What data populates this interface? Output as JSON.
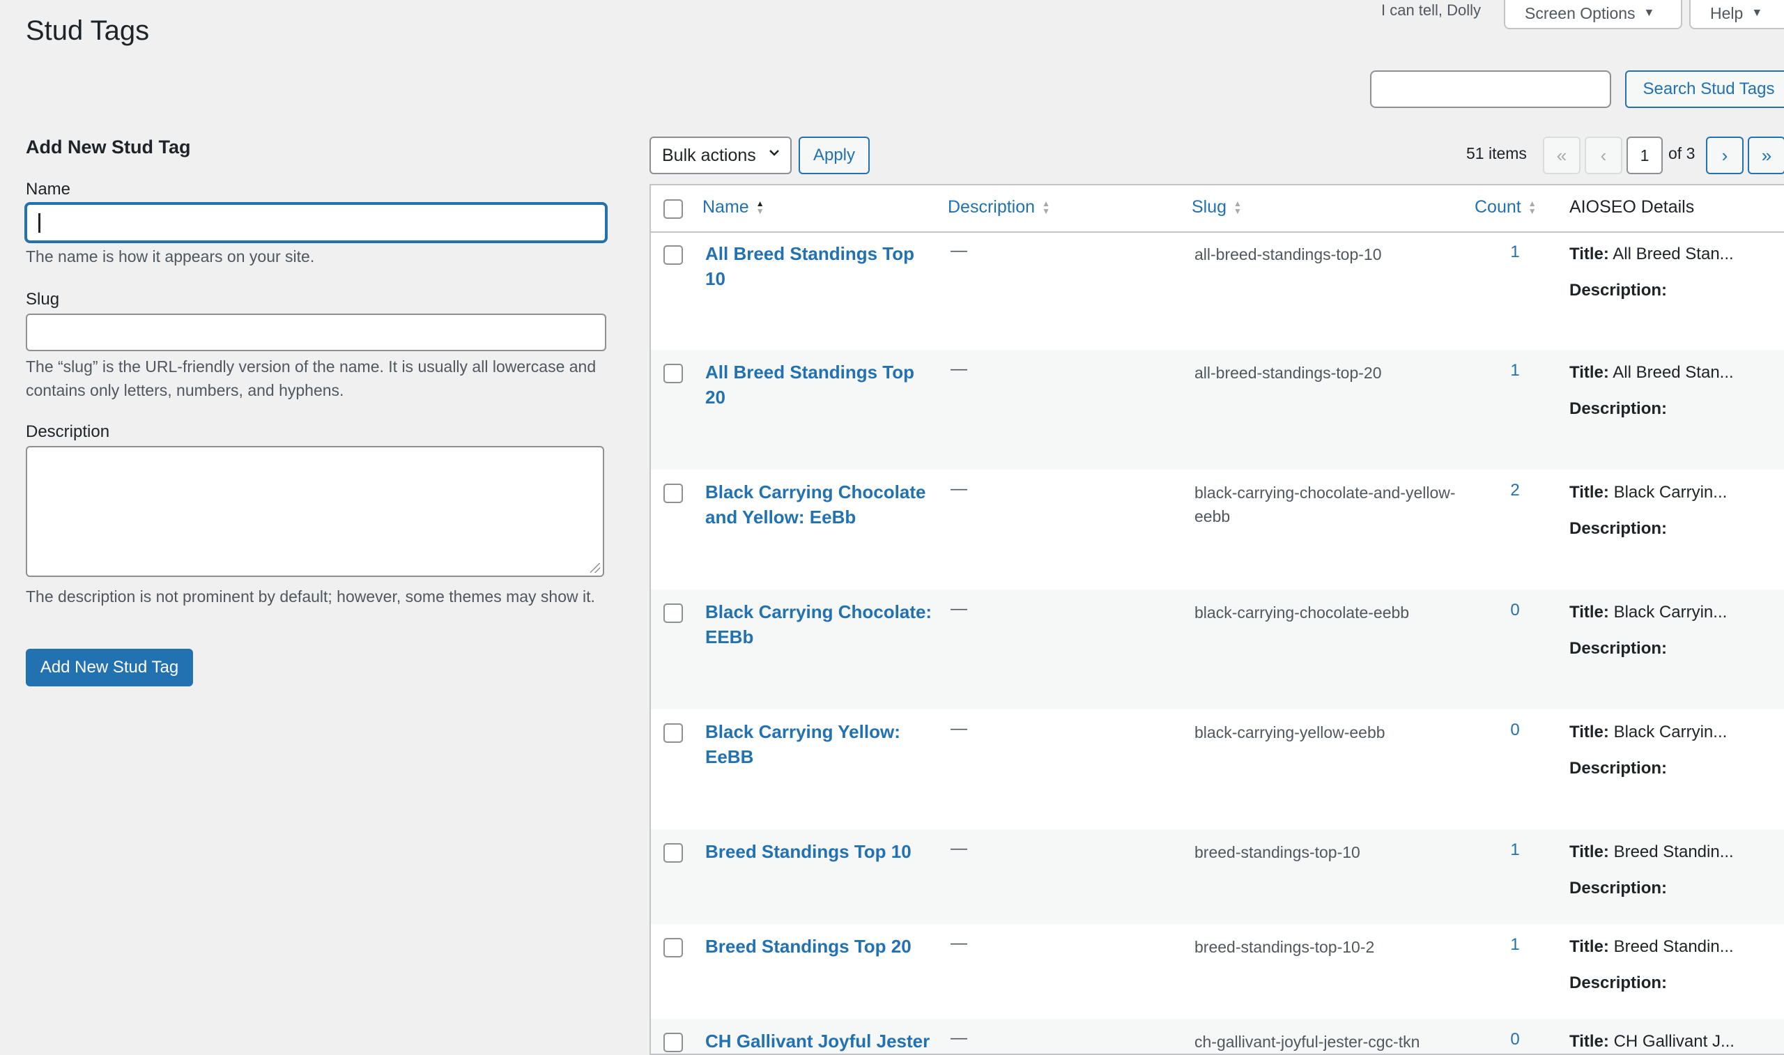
{
  "page": {
    "title": "Stud Tags",
    "dolly": "I can tell, Dolly",
    "screen_options": "Screen Options",
    "help": "Help",
    "search_button": "Search Stud Tags"
  },
  "form": {
    "heading": "Add New Stud Tag",
    "name_label": "Name",
    "name_help": "The name is how it appears on your site.",
    "slug_label": "Slug",
    "slug_help": "The “slug” is the URL-friendly version of the name. It is usually all lowercase and contains only letters, numbers, and hyphens.",
    "desc_label": "Description",
    "desc_help": "The description is not prominent by default; however, some themes may show it.",
    "submit": "Add New Stud Tag"
  },
  "toolbar": {
    "bulk_actions": "Bulk actions",
    "apply": "Apply",
    "items_count": "51 items",
    "first": "«",
    "prev": "‹",
    "current_page": "1",
    "of_pages": "of 3",
    "next": "›",
    "last": "»"
  },
  "table": {
    "columns": {
      "name": "Name",
      "description": "Description",
      "slug": "Slug",
      "count": "Count",
      "aioseo": "AIOSEO Details"
    },
    "title_label": "Title:",
    "description_label": "Description:",
    "rows": [
      {
        "name": "All Breed Standings Top 10",
        "description": "—",
        "slug": "all-breed-standings-top-10",
        "count": "1",
        "aio_title": "All Breed Stan..."
      },
      {
        "name": "All Breed Standings Top 20",
        "description": "—",
        "slug": "all-breed-standings-top-20",
        "count": "1",
        "aio_title": "All Breed Stan..."
      },
      {
        "name": "Black Carrying Chocolate and Yellow: EeBb",
        "description": "—",
        "slug": "black-carrying-chocolate-and-yellow-eebb",
        "count": "2",
        "aio_title": "Black Carryin..."
      },
      {
        "name": "Black Carrying Chocolate: EEBb",
        "description": "—",
        "slug": "black-carrying-chocolate-eebb",
        "count": "0",
        "aio_title": "Black Carryin..."
      },
      {
        "name": "Black Carrying Yellow: EeBB",
        "description": "—",
        "slug": "black-carrying-yellow-eebb",
        "count": "0",
        "aio_title": "Black Carryin..."
      },
      {
        "name": "Breed Standings Top 10",
        "description": "—",
        "slug": "breed-standings-top-10",
        "count": "1",
        "aio_title": "Breed Standin..."
      },
      {
        "name": "Breed Standings Top 20",
        "description": "—",
        "slug": "breed-standings-top-10-2",
        "count": "1",
        "aio_title": "Breed Standin..."
      },
      {
        "name": "CH Gallivant Joyful Jester",
        "description": "—",
        "slug": "ch-gallivant-joyful-jester-cgc-tkn",
        "count": "0",
        "aio_title": "CH Gallivant J..."
      }
    ]
  }
}
